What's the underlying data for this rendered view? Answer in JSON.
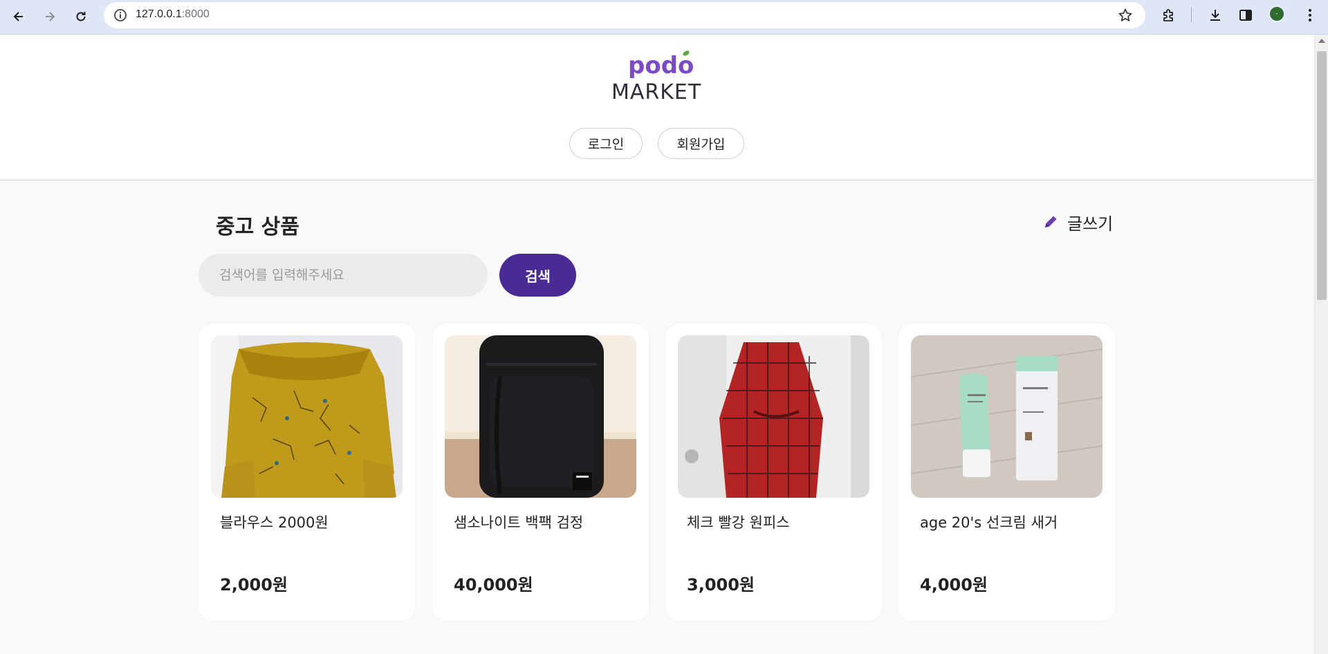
{
  "browser": {
    "url_host": "127.0.0.1",
    "url_port": ":8000",
    "icons": [
      "back-icon",
      "forward-icon",
      "reload-icon",
      "info-icon",
      "bookmark-star-icon",
      "extensions-icon",
      "download-icon",
      "side-panel-icon",
      "profile-avatar",
      "more-menu-icon"
    ]
  },
  "header": {
    "logo_top": "podo",
    "logo_bottom": "MARKET",
    "login_label": "로그인",
    "signup_label": "회원가입"
  },
  "main": {
    "title": "중고 상품",
    "write_label": "글쓰기",
    "search_placeholder": "검색어를 입력해주세요",
    "search_button": "검색"
  },
  "products": [
    {
      "name": "블라우스 2000원",
      "price": "2,000원",
      "image": "yellow floral blouse"
    },
    {
      "name": "샘소나이트 백팩 검정",
      "price": "40,000원",
      "image": "black backpack"
    },
    {
      "name": "체크 빨강 원피스",
      "price": "3,000원",
      "image": "red plaid dress"
    },
    {
      "name": "age 20's 선크림 새거",
      "price": "4,000원",
      "image": "sunscreen tube and box"
    }
  ],
  "colors": {
    "brand_purple": "#4a2a94",
    "logo_purple": "#7a4bc4",
    "leaf_green": "#5aa83a"
  }
}
